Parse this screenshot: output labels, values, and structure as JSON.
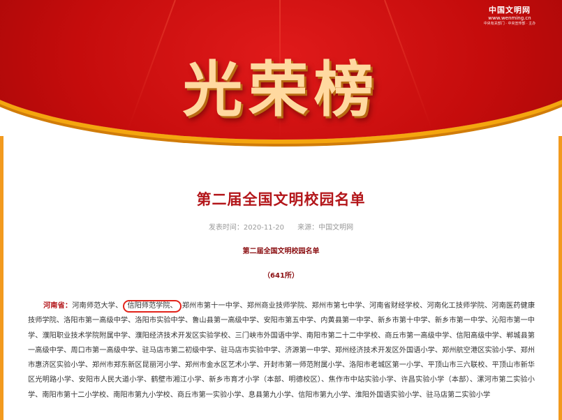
{
  "banner": {
    "title": "光荣榜",
    "logo_name": "中国文明网",
    "logo_url": "www.wenming.cn",
    "logo_slogan": "中央有关部门 · 中央宣传部 · 主办"
  },
  "article": {
    "headline": "第二届全国文明校园名单",
    "meta_date": "发表时间：2020-11-20",
    "meta_source": "来源：中国文明网",
    "subhead": "第二届全国文明校园名单",
    "count": "（641所）"
  },
  "list": {
    "province": "河南省：",
    "before_highlight": "河南师范大学、",
    "highlight": "信阳师范学院、",
    "after_highlight": "郑州市第十一中学、郑州商业技师学院、郑州市第七中学、河南省财经学校、河南化工技师学院、河南医药健康技师学院、洛阳市第一高级中学、洛阳市实验中学、鲁山县第一高级中学、安阳市第五中学、内黄县第一中学、新乡市第十中学、新乡市第一中学、沁阳市第一中学、濮阳职业技术学院附属中学、濮阳经济技术开发区实验学校、三门峡市外国语中学、南阳市第二十二中学校、商丘市第一高级中学、信阳高级中学、郸城县第一高级中学、周口市第一高级中学、驻马店市第二初级中学、驻马店市实验中学、济源第一中学、郑州经济技术开发区外国语小学、郑州航空港区实验小学、郑州市惠济区实验小学、郑州市郑东新区昆丽河小学、郑州市金水区艺术小学、开封市第一师范附属小学、洛阳市老城区第一小学、平顶山市三六联校、平顶山市新华区光明路小学、安阳市人民大道小学、鹤壁市湘江小学、新乡市育才小学（本部、明德校区）、焦作市中站实验小学、许昌实验小学（本部）、漯河市第二实验小学、南阳市第十二小学校、南阳市第九小学校、商丘市第一实验小学、息县第九小学、信阳市第九小学、淮阳外国语实验小学、驻马店第二实验小学"
  }
}
